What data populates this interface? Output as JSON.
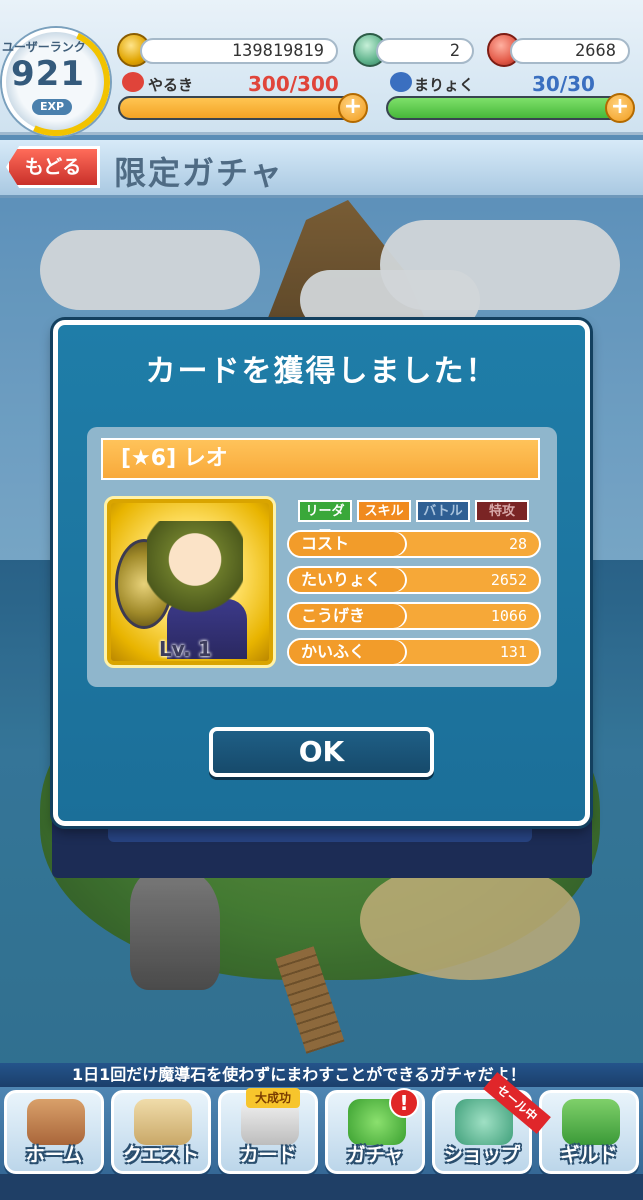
{
  "status": {
    "rank_label": "ユーザーランク",
    "rank": "921",
    "exp_label": "EXP",
    "coins": "139819819",
    "magic_stones": "2",
    "tickets": "2668",
    "stamina_label": "やるき",
    "stamina_value": "300/300",
    "stamina_fill": 1.0,
    "mana_label": "まりょく",
    "mana_value": "30/30",
    "mana_fill": 1.0,
    "plus": "+"
  },
  "header": {
    "back_label": "もどる",
    "title": "限定ガチャ"
  },
  "modal": {
    "title": "カードを獲得しました！",
    "card_name": "[★6] レオ",
    "level": "Lv. 1",
    "tags": [
      "リーダー",
      "スキル",
      "バトル",
      "特攻"
    ],
    "stats": [
      {
        "label": "コスト",
        "value": "28"
      },
      {
        "label": "たいりょく",
        "value": "2652"
      },
      {
        "label": "こうげき",
        "value": "1066"
      },
      {
        "label": "かいふく",
        "value": "131"
      }
    ],
    "ok_label": "OK"
  },
  "ticker": "1日1回だけ魔導石を使わずにまわすことができるガチャだよ！",
  "nav": {
    "items": [
      "ホーム",
      "クエスト",
      "カード",
      "ガチャ",
      "ショップ",
      "ギルド"
    ],
    "card_badge": "大成功",
    "gacha_badge": "!",
    "shop_badge": "セール中"
  },
  "colors": {
    "modal_bg": "#1f7da8",
    "stat_orange": "#f6a838",
    "stamina_bar": "#f3a324",
    "mana_bar": "#47b83a",
    "back_button": "#e0443a"
  }
}
